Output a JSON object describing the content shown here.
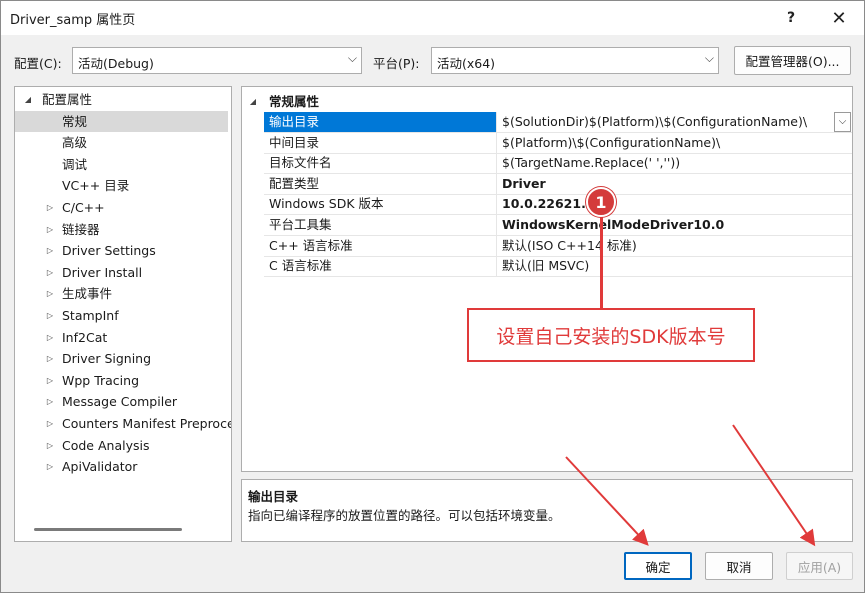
{
  "window": {
    "title": "Driver_samp 属性页",
    "help": "?",
    "close": "✕"
  },
  "toolbar": {
    "config_label": "配置(C):",
    "config_value": "活动(Debug)",
    "platform_label": "平台(P):",
    "platform_value": "活动(x64)",
    "config_manager": "配置管理器(O)..."
  },
  "tree": {
    "items": [
      {
        "label": "配置属性",
        "level": 0,
        "toggle": "◢",
        "selected": false
      },
      {
        "label": "常规",
        "level": 1,
        "toggle": "",
        "selected": true
      },
      {
        "label": "高级",
        "level": 1,
        "toggle": "",
        "selected": false
      },
      {
        "label": "调试",
        "level": 1,
        "toggle": "",
        "selected": false
      },
      {
        "label": "VC++ 目录",
        "level": 1,
        "toggle": "",
        "selected": false
      },
      {
        "label": "C/C++",
        "level": 1,
        "toggle": "▷",
        "selected": false
      },
      {
        "label": "链接器",
        "level": 1,
        "toggle": "▷",
        "selected": false
      },
      {
        "label": "Driver Settings",
        "level": 1,
        "toggle": "▷",
        "selected": false
      },
      {
        "label": "Driver Install",
        "level": 1,
        "toggle": "▷",
        "selected": false
      },
      {
        "label": "生成事件",
        "level": 1,
        "toggle": "▷",
        "selected": false
      },
      {
        "label": "StampInf",
        "level": 1,
        "toggle": "▷",
        "selected": false
      },
      {
        "label": "Inf2Cat",
        "level": 1,
        "toggle": "▷",
        "selected": false
      },
      {
        "label": "Driver Signing",
        "level": 1,
        "toggle": "▷",
        "selected": false
      },
      {
        "label": "Wpp Tracing",
        "level": 1,
        "toggle": "▷",
        "selected": false
      },
      {
        "label": "Message Compiler",
        "level": 1,
        "toggle": "▷",
        "selected": false
      },
      {
        "label": "Counters Manifest Preprocessor",
        "level": 1,
        "toggle": "▷",
        "selected": false
      },
      {
        "label": "Code Analysis",
        "level": 1,
        "toggle": "▷",
        "selected": false
      },
      {
        "label": "ApiValidator",
        "level": 1,
        "toggle": "▷",
        "selected": false
      }
    ]
  },
  "grid": {
    "category": "常规属性",
    "category_toggle": "◢",
    "rows": [
      {
        "name": "输出目录",
        "value": "$(SolutionDir)$(Platform)\\$(ConfigurationName)\\",
        "bold": false,
        "selected": true
      },
      {
        "name": "中间目录",
        "value": "$(Platform)\\$(ConfigurationName)\\",
        "bold": false,
        "selected": false
      },
      {
        "name": "目标文件名",
        "value": "$(TargetName.Replace(' ',''))",
        "bold": false,
        "selected": false
      },
      {
        "name": "配置类型",
        "value": "Driver",
        "bold": true,
        "selected": false
      },
      {
        "name": "Windows SDK 版本",
        "value": "10.0.22621.0",
        "bold": true,
        "selected": false
      },
      {
        "name": "平台工具集",
        "value": "WindowsKernelModeDriver10.0",
        "bold": true,
        "selected": false
      },
      {
        "name": "C++ 语言标准",
        "value": "默认(ISO C++14 标准)",
        "bold": false,
        "selected": false
      },
      {
        "name": "C 语言标准",
        "value": "默认(旧 MSVC)",
        "bold": false,
        "selected": false
      }
    ],
    "dropdown_glyph": "⌵"
  },
  "description": {
    "title": "输出目录",
    "text": "指向已编译程序的放置位置的路径。可以包括环境变量。"
  },
  "buttons": {
    "ok": "确定",
    "cancel": "取消",
    "apply": "应用(A)"
  },
  "annotation": {
    "marker": "1",
    "text": "设置自己安装的SDK版本号",
    "color": "#e03a3a"
  },
  "colors": {
    "selection": "#0078d7",
    "tree_selection": "#d9d9d9",
    "primary_border": "#0067c0"
  }
}
